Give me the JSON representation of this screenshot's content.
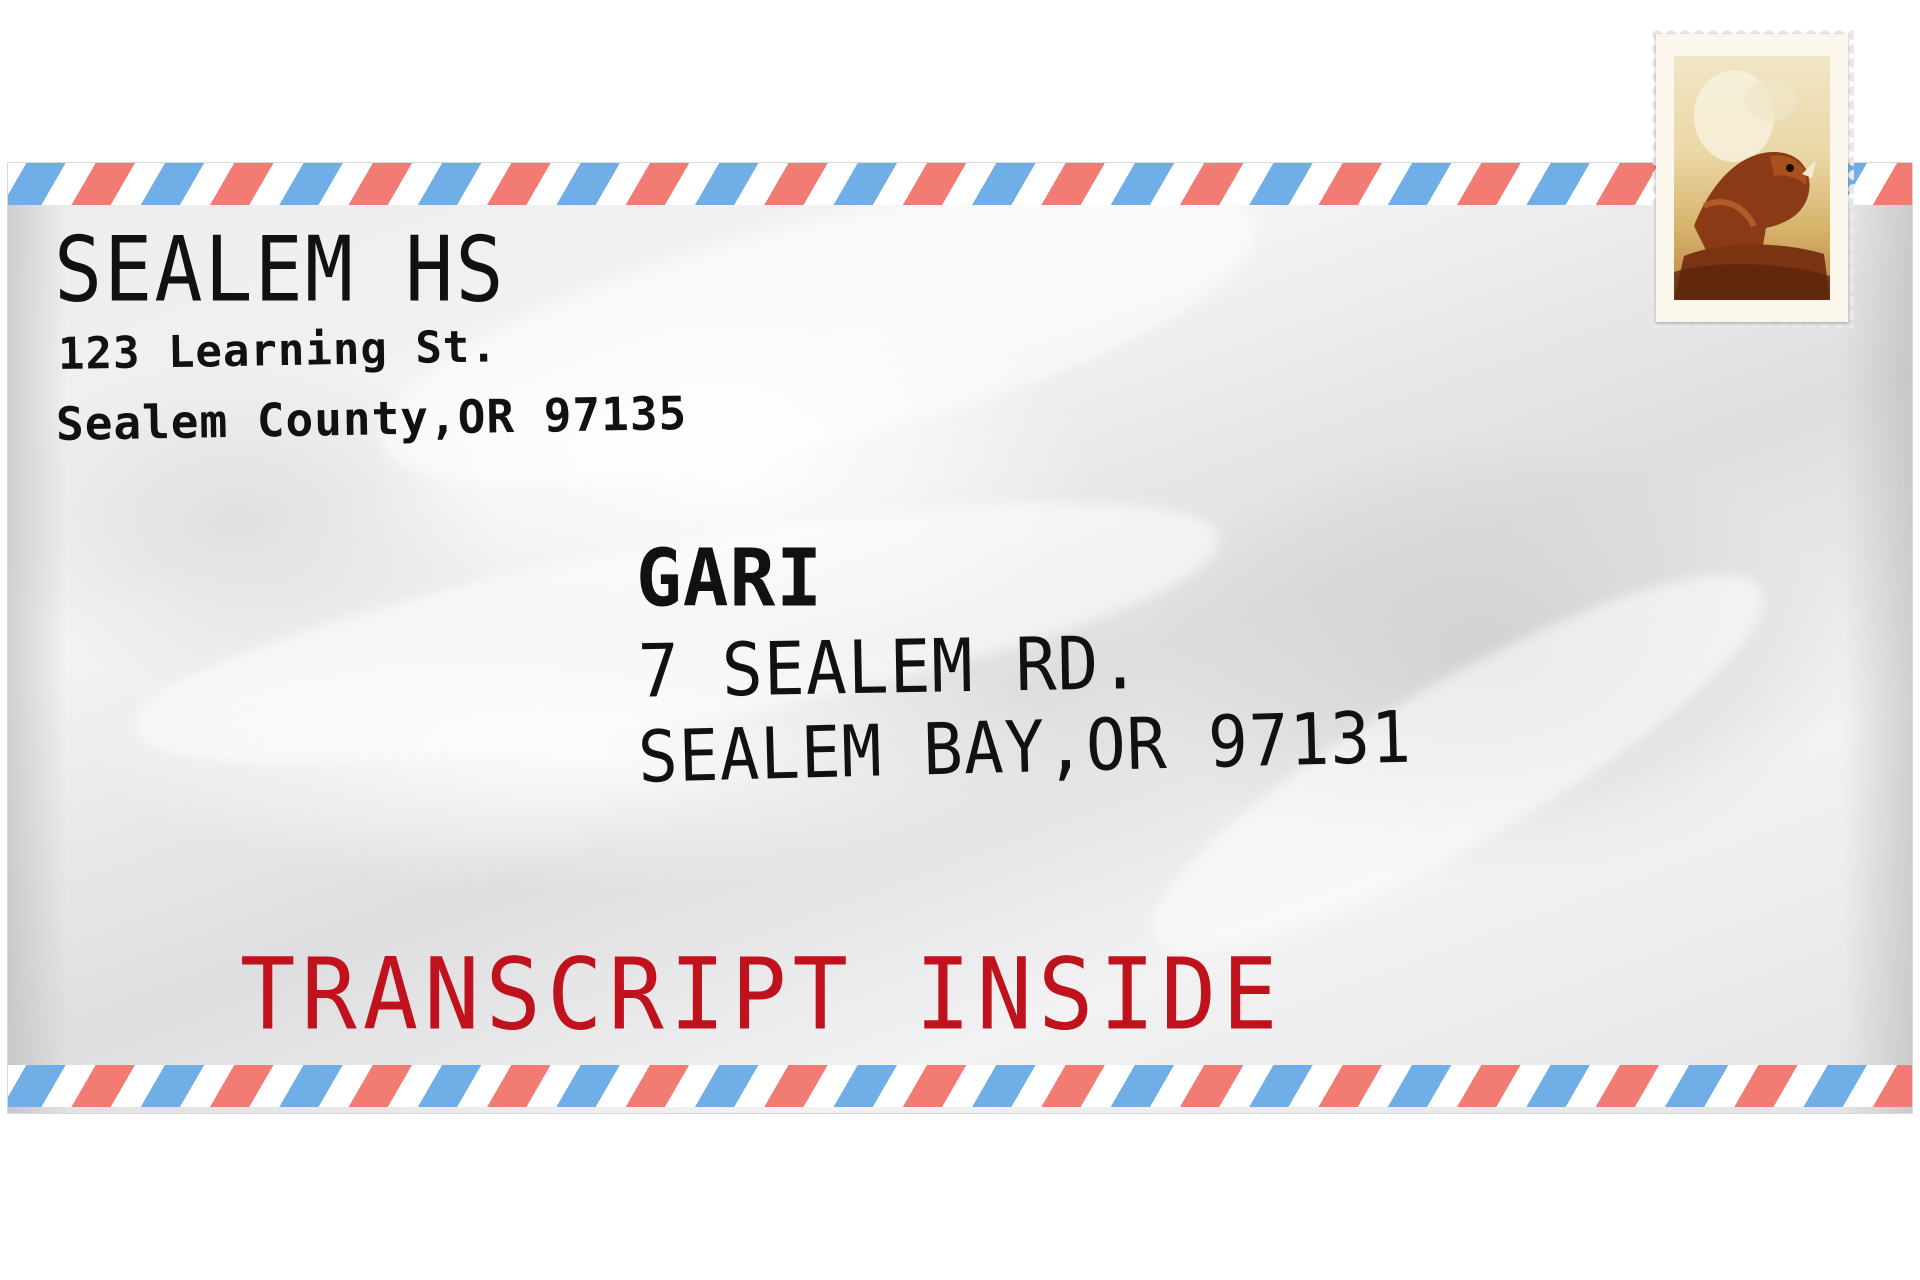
{
  "envelope": {
    "sender": {
      "name": "SEALEM HS",
      "street": "123 Learning St.",
      "city": "Sealem County,OR 97135"
    },
    "recipient": {
      "name": "GARI",
      "street": "7 SEALEM RD.",
      "city": "SEALEM BAY,OR 97131"
    },
    "note": "TRANSCRIPT INSIDE",
    "stamp_icon": "beaver-stamp-icon",
    "colors": {
      "note_red": "#c0121c",
      "stripe_red": "#f27b74",
      "stripe_blue": "#6faee6",
      "ink": "#111111"
    }
  }
}
